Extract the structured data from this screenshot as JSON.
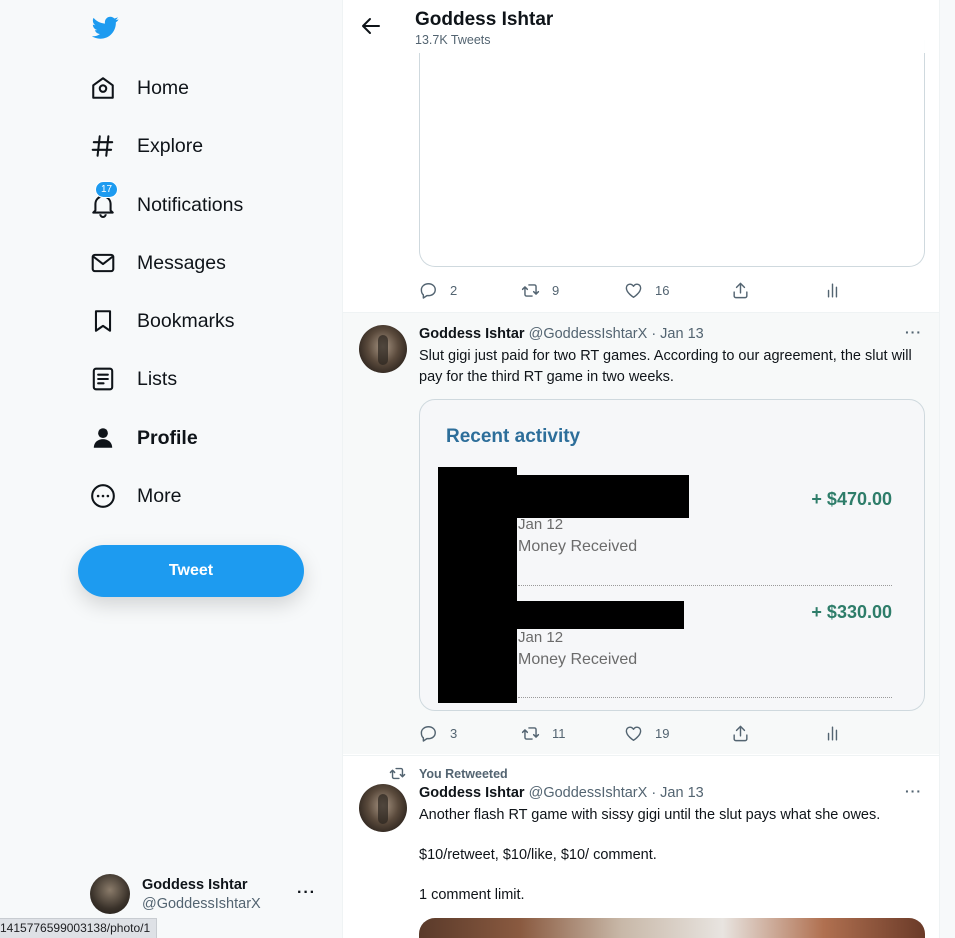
{
  "nav": {
    "items": [
      {
        "label": "Home",
        "icon": "home-icon"
      },
      {
        "label": "Explore",
        "icon": "hashtag-icon"
      },
      {
        "label": "Notifications",
        "icon": "bell-icon",
        "badge": "17"
      },
      {
        "label": "Messages",
        "icon": "envelope-icon"
      },
      {
        "label": "Bookmarks",
        "icon": "bookmark-icon"
      },
      {
        "label": "Lists",
        "icon": "list-icon"
      },
      {
        "label": "Profile",
        "icon": "person-icon"
      },
      {
        "label": "More",
        "icon": "more-circle-icon"
      }
    ],
    "tweet_button": "Tweet"
  },
  "account": {
    "name": "Goddess Ishtar",
    "handle": "@GoddessIshtarX",
    "more": "···"
  },
  "status_bar": {
    "url": "1415776599003138/photo/1"
  },
  "header": {
    "title": "Goddess Ishtar",
    "subtitle": "13.7K Tweets"
  },
  "tweets": [
    {
      "stats": {
        "replies": "2",
        "retweets": "9",
        "likes": "16"
      }
    },
    {
      "name": "Goddess Ishtar",
      "meta": "@GoddessIshtarX · Jan 13",
      "text": "Slut gigi just paid for two RT games. According to our agreement, the slut will pay for the third RT game in two weeks.",
      "card": {
        "title": "Recent activity",
        "transactions": [
          {
            "date": "Jan 12",
            "desc": "Money Received",
            "amount": "+ $470.00"
          },
          {
            "date": "Jan 12",
            "desc": "Money Received",
            "amount": "+ $330.00"
          }
        ]
      },
      "stats": {
        "replies": "3",
        "retweets": "11",
        "likes": "19"
      }
    },
    {
      "retweeted_label": "You Retweeted",
      "name": "Goddess Ishtar",
      "meta": "@GoddessIshtarX · Jan 13",
      "text_lines": [
        "Another flash RT game with sissy gigi until the slut pays what she owes.",
        "$10/retweet, $10/like, $10/ comment.",
        "1 comment limit."
      ]
    }
  ],
  "colors": {
    "accent": "#1d9bf0",
    "amount_green": "#2e7d6a",
    "card_title": "#2d6e9a"
  }
}
